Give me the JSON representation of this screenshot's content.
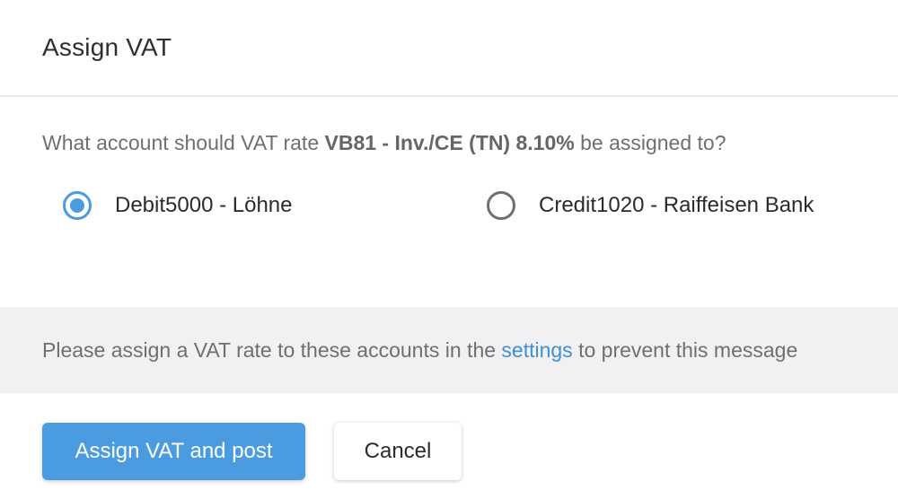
{
  "dialog": {
    "title": "Assign VAT",
    "question": {
      "prefix": "What account should VAT rate ",
      "rate": "VB81 - Inv./CE (TN) 8.10%",
      "suffix": " be assigned to?"
    },
    "options": [
      {
        "label": "Debit5000 - Löhne",
        "selected": true
      },
      {
        "label": "Credit1020 - Raiffeisen Bank",
        "selected": false
      }
    ],
    "notice": {
      "prefix": "Please assign a VAT rate to these accounts in the ",
      "link": "settings",
      "suffix": " to prevent this message"
    },
    "buttons": {
      "primary": "Assign VAT and post",
      "secondary": "Cancel"
    }
  },
  "colors": {
    "accent": "#4a9be0",
    "link": "#3d8fd6",
    "notice_bg": "#f1f0f2"
  }
}
